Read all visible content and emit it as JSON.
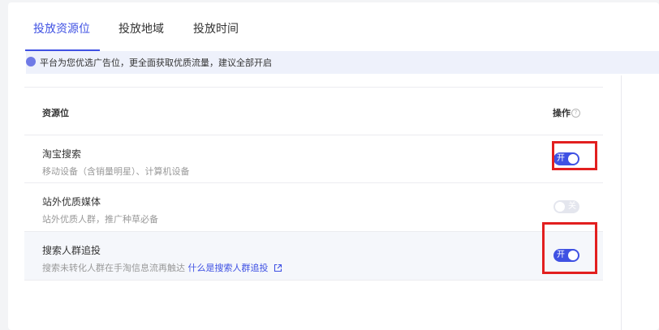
{
  "tabs": [
    {
      "label": "投放资源位",
      "active": true
    },
    {
      "label": "投放地域",
      "active": false
    },
    {
      "label": "投放时间",
      "active": false
    }
  ],
  "notice": {
    "text": "平台为您优选广告位，更全面获取优质流量，建议全部开启",
    "dot_color": "#6f7ae6"
  },
  "table": {
    "col_resource": "资源位",
    "col_action": "操作",
    "help_icon": "?",
    "rows": [
      {
        "title": "淘宝搜索",
        "desc": "移动设备（含销量明星）、计算机设备",
        "toggle_on": true,
        "toggle_label": "开"
      },
      {
        "title": "站外优质媒体",
        "desc": "站外优质人群，推广种草必备",
        "toggle_on": false,
        "toggle_label": "关"
      },
      {
        "title": "搜索人群追投",
        "desc": "搜索未转化人群在手淘信息流再触达",
        "link": "什么是搜索人群追投",
        "toggle_on": true,
        "toggle_label": "开"
      }
    ]
  },
  "colors": {
    "accent": "#3f51e3",
    "highlight_box": "#e21f1f"
  }
}
